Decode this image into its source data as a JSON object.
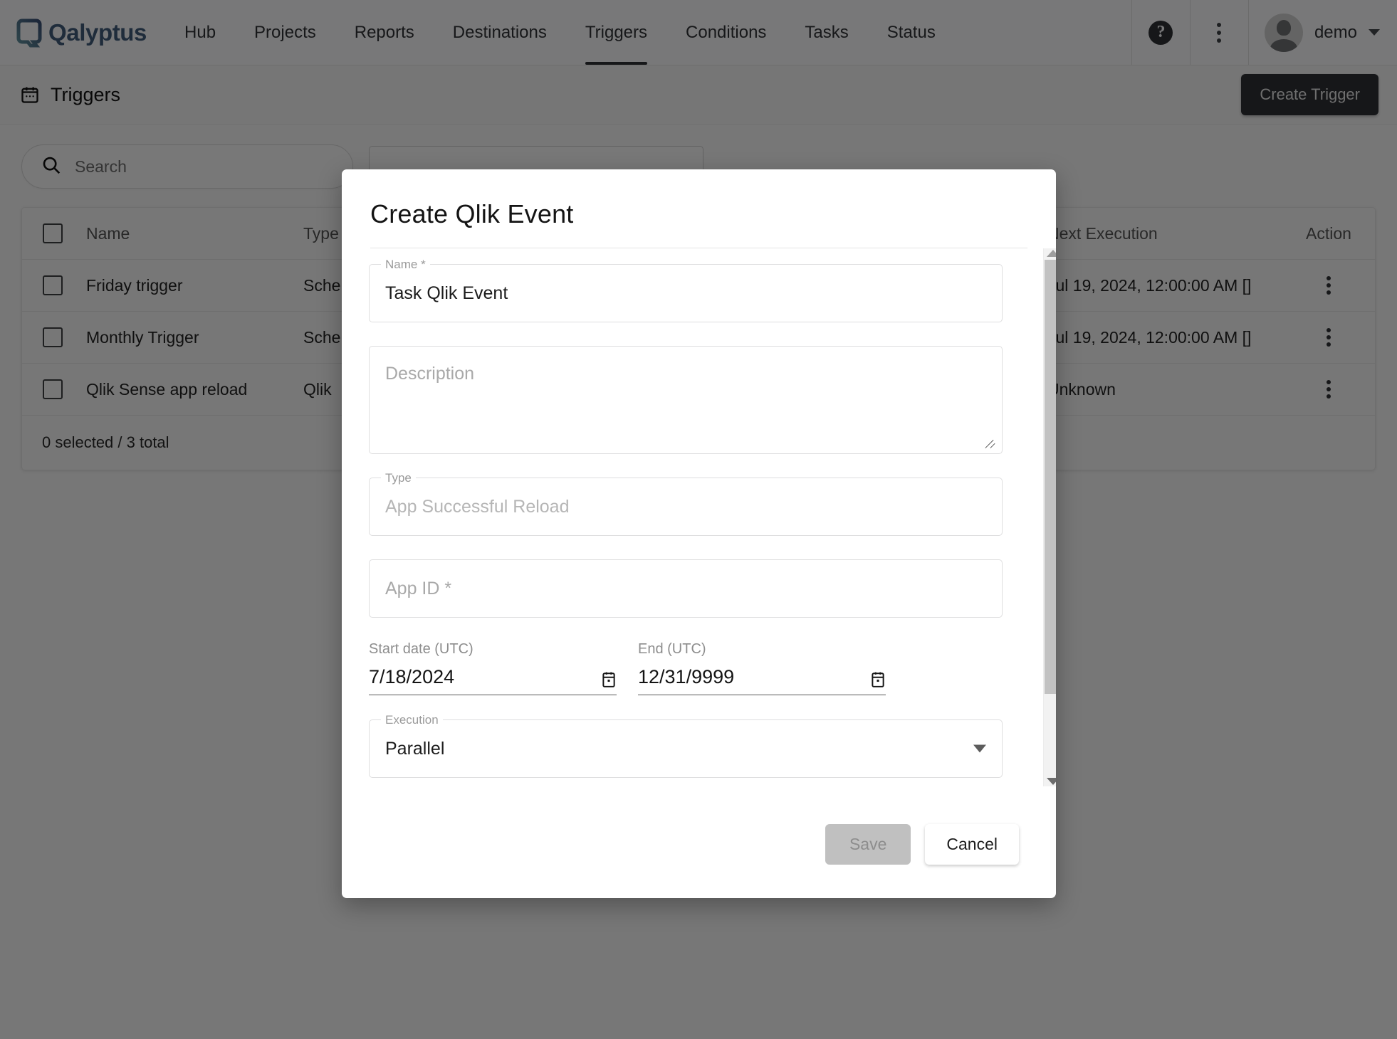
{
  "nav": {
    "brand": "Qalyptus",
    "brand_color": "#1565c0",
    "links": [
      {
        "label": "Hub",
        "active": false
      },
      {
        "label": "Projects",
        "active": false
      },
      {
        "label": "Reports",
        "active": false
      },
      {
        "label": "Destinations",
        "active": false
      },
      {
        "label": "Triggers",
        "active": true
      },
      {
        "label": "Conditions",
        "active": false
      },
      {
        "label": "Tasks",
        "active": false
      },
      {
        "label": "Status",
        "active": false
      }
    ],
    "help_glyph": "?",
    "user": "demo"
  },
  "pageheader": {
    "title": "Triggers",
    "icon": "calendar-icon",
    "create_button": "Create Trigger"
  },
  "toolbar": {
    "search_placeholder": "Search",
    "search_value": ""
  },
  "table": {
    "columns": [
      "Name",
      "Type",
      "Next Execution",
      "Action"
    ],
    "rows": [
      {
        "name": "Friday trigger",
        "type": "Sche",
        "next": "Jul 19, 2024, 12:00:00 AM []"
      },
      {
        "name": "Monthly Trigger",
        "type": "Sche",
        "next": "Jul 19, 2024, 12:00:00 AM []"
      },
      {
        "name": "Qlik Sense app reload",
        "type": "Qlik",
        "next": "Unknown"
      }
    ],
    "footer": "0 selected / 3 total"
  },
  "modal": {
    "title": "Create Qlik Event",
    "name_label": "Name *",
    "name_value": "Task Qlik Event",
    "description_placeholder": "Description",
    "description_value": "",
    "type_label": "Type",
    "type_value": "App Successful Reload",
    "appid_placeholder": "App ID *",
    "appid_value": "",
    "start_date_label": "Start date (UTC)",
    "start_date_value": "7/18/2024",
    "end_date_label": "End (UTC)",
    "end_date_value": "12/31/9999",
    "execution_label": "Execution",
    "execution_value": "Parallel",
    "save_label": "Save",
    "cancel_label": "Cancel"
  }
}
